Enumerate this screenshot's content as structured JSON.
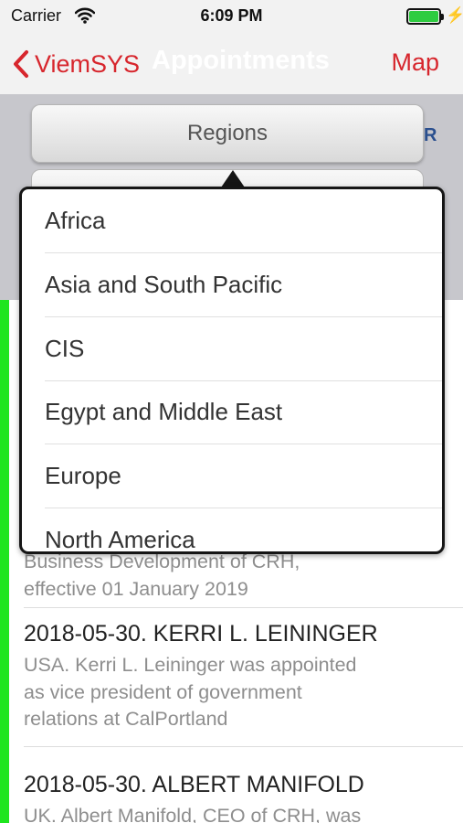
{
  "status_bar": {
    "carrier": "Carrier",
    "time": "6:09 PM",
    "wifi_icon": "wifi-icon",
    "battery_icon": "battery-icon",
    "charging_icon": "charging-bolt-icon",
    "bolt_glyph": "⚡"
  },
  "nav": {
    "back_label": "ViemSYS",
    "title": "Appointments",
    "right_label": "Map",
    "accent_color": "#d7262d"
  },
  "filter": {
    "regions_label": "Regions",
    "peek_letter": "R"
  },
  "regions_dropdown": {
    "options": [
      "Africa",
      "Asia and South Pacific",
      "CIS",
      "Egypt and Middle East",
      "Europe",
      "North America"
    ]
  },
  "list": {
    "items": [
      {
        "title": "",
        "body_lines": [
          "Business Development of CRH,",
          "effective 01 January 2019"
        ]
      },
      {
        "title": "2018-05-30. KERRI L.  LEININGER",
        "body_lines": [
          "USA. Kerri L. Leininger was appointed",
          "as vice president of government",
          "relations  at CalPortland"
        ]
      },
      {
        "title": "2018-05-30. ALBERT MANIFOLD",
        "body_lines": [
          "UK. Albert Manifold, CEO of CRH, was"
        ]
      }
    ],
    "indicator_color": "#1ee51e"
  }
}
